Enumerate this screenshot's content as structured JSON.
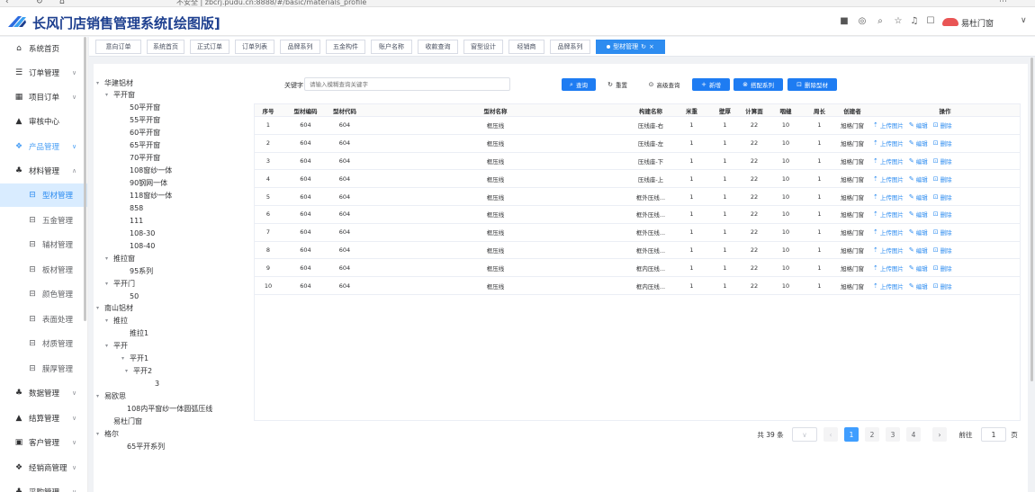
{
  "browser": {
    "url": "不安全 | zbcrj.pudu.cn:8888/#/basic/materials_profile"
  },
  "header": {
    "app_title": "长风门店销售管理系统[绘图版]",
    "user_name": "易杜门窗",
    "icons": [
      "dark-mode-icon",
      "settings-icon",
      "search-icon",
      "theme-icon",
      "bell-icon",
      "message-icon",
      "user-icon"
    ]
  },
  "sidebar": {
    "items": [
      {
        "icon": "home-icon",
        "label": "系统首页",
        "chevron": "",
        "type": "top",
        "state": ""
      },
      {
        "icon": "order-icon",
        "label": "订单管理",
        "chevron": "∨",
        "type": "top",
        "state": ""
      },
      {
        "icon": "project-icon",
        "label": "项目订单",
        "chevron": "∨",
        "type": "top",
        "state": ""
      },
      {
        "icon": "audit-icon",
        "label": "审核中心",
        "chevron": "",
        "type": "top",
        "state": ""
      },
      {
        "icon": "product-icon",
        "label": "产品管理",
        "chevron": "∨",
        "type": "top",
        "state": "group-active"
      },
      {
        "icon": "material-icon",
        "label": "材料管理",
        "chevron": "∧",
        "type": "top",
        "state": ""
      },
      {
        "icon": "box-icon",
        "label": "型材管理",
        "chevron": "",
        "type": "sub",
        "state": "active"
      },
      {
        "icon": "box-icon",
        "label": "五金管理",
        "chevron": "",
        "type": "sub",
        "state": ""
      },
      {
        "icon": "box-icon",
        "label": "辅材管理",
        "chevron": "",
        "type": "sub",
        "state": ""
      },
      {
        "icon": "box-icon",
        "label": "板材管理",
        "chevron": "",
        "type": "sub",
        "state": ""
      },
      {
        "icon": "box-icon",
        "label": "颜色管理",
        "chevron": "",
        "type": "sub",
        "state": ""
      },
      {
        "icon": "box-icon",
        "label": "表面处理",
        "chevron": "",
        "type": "sub",
        "state": ""
      },
      {
        "icon": "box-icon",
        "label": "材质管理",
        "chevron": "",
        "type": "sub",
        "state": ""
      },
      {
        "icon": "box-icon",
        "label": "膜厚管理",
        "chevron": "",
        "type": "sub",
        "state": ""
      },
      {
        "icon": "data-icon",
        "label": "数据管理",
        "chevron": "∨",
        "type": "top",
        "state": ""
      },
      {
        "icon": "settle-icon",
        "label": "结算管理",
        "chevron": "∨",
        "type": "top",
        "state": ""
      },
      {
        "icon": "customer-icon",
        "label": "客户管理",
        "chevron": "∨",
        "type": "top",
        "state": ""
      },
      {
        "icon": "dealer-icon",
        "label": "经销商管理",
        "chevron": "∨",
        "type": "top",
        "state": ""
      },
      {
        "icon": "purchase-icon",
        "label": "采购管理",
        "chevron": "∨",
        "type": "top",
        "state": ""
      }
    ]
  },
  "tabs": [
    {
      "label": "意向订单",
      "active": false
    },
    {
      "label": "系统首页",
      "active": false
    },
    {
      "label": "正式订单",
      "active": false
    },
    {
      "label": "订单列表",
      "active": false
    },
    {
      "label": "品牌系列",
      "active": false
    },
    {
      "label": "五金构件",
      "active": false
    },
    {
      "label": "账户名称",
      "active": false
    },
    {
      "label": "收款查询",
      "active": false
    },
    {
      "label": "窗型设计",
      "active": false
    },
    {
      "label": "经销商",
      "active": false
    },
    {
      "label": "品牌系列",
      "active": false
    },
    {
      "label": "型材管理",
      "active": true
    }
  ],
  "tree": [
    {
      "label": "华建铝材",
      "level": 0,
      "arrow": "▾"
    },
    {
      "label": "平开窗",
      "level": 1,
      "arrow": "▾"
    },
    {
      "label": "50平开窗",
      "level": 2,
      "arrow": ""
    },
    {
      "label": "55平开窗",
      "level": 2,
      "arrow": ""
    },
    {
      "label": "60平开窗",
      "level": 2,
      "arrow": ""
    },
    {
      "label": "65平开窗",
      "level": 2,
      "arrow": ""
    },
    {
      "label": "70平开窗",
      "level": 2,
      "arrow": ""
    },
    {
      "label": "108窗纱一体",
      "level": 2,
      "arrow": ""
    },
    {
      "label": "90钢网一体",
      "level": 2,
      "arrow": ""
    },
    {
      "label": "118窗纱一体",
      "level": 2,
      "arrow": ""
    },
    {
      "label": "858",
      "level": 2,
      "arrow": ""
    },
    {
      "label": "111",
      "level": 2,
      "arrow": ""
    },
    {
      "label": "108-30",
      "level": 2,
      "arrow": ""
    },
    {
      "label": "108-40",
      "level": 2,
      "arrow": ""
    },
    {
      "label": "推拉窗",
      "level": 1,
      "arrow": "▾"
    },
    {
      "label": "95系列",
      "level": 2,
      "arrow": ""
    },
    {
      "label": "平开门",
      "level": 1,
      "arrow": "▾"
    },
    {
      "label": "50",
      "level": 2,
      "arrow": ""
    },
    {
      "label": "南山铝材",
      "level": 0,
      "arrow": "▾"
    },
    {
      "label": "推拉",
      "level": 1,
      "arrow": "▾"
    },
    {
      "label": "推拉1",
      "level": 2,
      "arrow": ""
    },
    {
      "label": "平开",
      "level": 1,
      "arrow": "▾"
    },
    {
      "label": "平开1",
      "level": 2,
      "arrow": "▾"
    },
    {
      "label": "平开2",
      "level": 3,
      "arrow": "▾"
    },
    {
      "label": "3",
      "level": 4,
      "arrow": ""
    },
    {
      "label": "易欧思",
      "level": 0,
      "arrow": "▾"
    },
    {
      "label": "108内平窗纱一体圆弧压线",
      "level": 2,
      "arrow": ""
    },
    {
      "label": "易杜门窗",
      "level": 1,
      "arrow": ""
    },
    {
      "label": "格尔",
      "level": 0,
      "arrow": "▾"
    },
    {
      "label": "65平开系列",
      "level": 2,
      "arrow": ""
    }
  ],
  "toolbar": {
    "keyword_label": "关键字",
    "search_placeholder": "请输入模糊查询关键字",
    "buttons": [
      {
        "label": "查询",
        "icon": "search-icon",
        "style": "primary"
      },
      {
        "label": "重置",
        "icon": "refresh-icon",
        "style": "plain"
      },
      {
        "label": "高级查询",
        "icon": "advanced-search-icon",
        "style": "plain"
      },
      {
        "label": "新增",
        "icon": "plus-icon",
        "style": "primary"
      },
      {
        "label": "搭配系列",
        "icon": "link-icon",
        "style": "primary"
      },
      {
        "label": "删除型材",
        "icon": "trash-icon",
        "style": "primary"
      }
    ]
  },
  "table": {
    "columns": [
      "序号",
      "型材编码",
      "型材代码",
      "型材名称",
      "构建名称",
      "米重",
      "壁厚",
      "计算面",
      "咽缝",
      "周长",
      "创建者",
      "操作"
    ],
    "rows": [
      [
        "1",
        "604",
        "604",
        "框压线",
        "压线座-右",
        "1",
        "1",
        "22",
        "10",
        "1",
        "旭格门窗"
      ],
      [
        "2",
        "604",
        "604",
        "框压线",
        "压线座-左",
        "1",
        "1",
        "22",
        "10",
        "1",
        "旭格门窗"
      ],
      [
        "3",
        "604",
        "604",
        "框压线",
        "压线座-下",
        "1",
        "1",
        "22",
        "10",
        "1",
        "旭格门窗"
      ],
      [
        "4",
        "604",
        "604",
        "框压线",
        "压线座-上",
        "1",
        "1",
        "22",
        "10",
        "1",
        "旭格门窗"
      ],
      [
        "5",
        "604",
        "604",
        "框压线",
        "框外压线...",
        "1",
        "1",
        "22",
        "10",
        "1",
        "旭格门窗"
      ],
      [
        "6",
        "604",
        "604",
        "框压线",
        "框外压线...",
        "1",
        "1",
        "22",
        "10",
        "1",
        "旭格门窗"
      ],
      [
        "7",
        "604",
        "604",
        "框压线",
        "框外压线...",
        "1",
        "1",
        "22",
        "10",
        "1",
        "旭格门窗"
      ],
      [
        "8",
        "604",
        "604",
        "框压线",
        "框外压线...",
        "1",
        "1",
        "22",
        "10",
        "1",
        "旭格门窗"
      ],
      [
        "9",
        "604",
        "604",
        "框压线",
        "框内压线...",
        "1",
        "1",
        "22",
        "10",
        "1",
        "旭格门窗"
      ],
      [
        "10",
        "604",
        "604",
        "框压线",
        "框内压线...",
        "1",
        "1",
        "22",
        "10",
        "1",
        "旭格门窗"
      ]
    ],
    "operations": [
      {
        "label": "上传图片",
        "icon": "upload-icon"
      },
      {
        "label": "编辑",
        "icon": "edit-icon"
      },
      {
        "label": "删除",
        "icon": "delete-icon"
      }
    ]
  },
  "pagination": {
    "total": "共 39 条",
    "pages": [
      "1",
      "2",
      "3",
      "4"
    ],
    "current": "1",
    "goto_label": "前往",
    "goto_value": "1",
    "page_suffix": "页"
  },
  "colors": {
    "primary": "#2d8cf0",
    "title": "#1d3f8f",
    "active_bg": "#d9ecff"
  }
}
